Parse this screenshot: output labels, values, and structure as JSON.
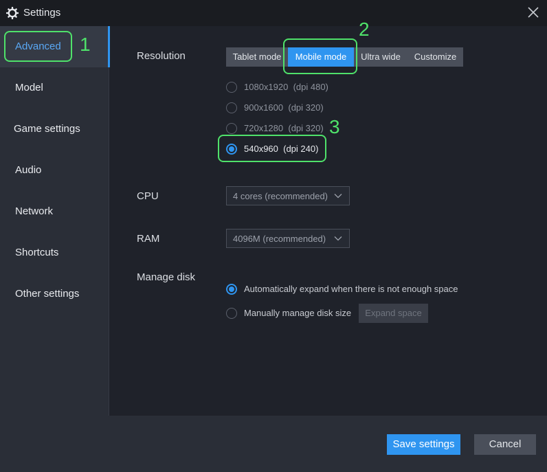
{
  "window": {
    "title": "Settings",
    "icon": "gear-icon",
    "close_icon": "close-icon"
  },
  "sidebar": {
    "items": [
      {
        "label": "Advanced",
        "active": true
      },
      {
        "label": "Model"
      },
      {
        "label": "Game settings"
      },
      {
        "label": "Audio"
      },
      {
        "label": "Network"
      },
      {
        "label": "Shortcuts"
      },
      {
        "label": "Other settings"
      }
    ]
  },
  "resolution": {
    "label": "Resolution",
    "modes": [
      "Tablet mode",
      "Mobile mode",
      "Ultra wide",
      "Customize"
    ],
    "selected_mode": "Mobile mode",
    "options": [
      {
        "size": "1080x1920",
        "dpi": "(dpi 480)",
        "checked": false
      },
      {
        "size": "900x1600",
        "dpi": "(dpi 320)",
        "checked": false
      },
      {
        "size": "720x1280",
        "dpi": "(dpi 320)",
        "checked": false
      },
      {
        "size": "540x960",
        "dpi": "(dpi 240)",
        "checked": true
      }
    ]
  },
  "cpu": {
    "label": "CPU",
    "value": "4 cores (recommended)"
  },
  "ram": {
    "label": "RAM",
    "value": "4096M (recommended)"
  },
  "disk": {
    "label": "Manage disk",
    "options": [
      {
        "text": "Automatically expand when there is not enough space",
        "checked": true
      },
      {
        "text": "Manually manage disk size",
        "checked": false
      }
    ],
    "expand_button": "Expand space"
  },
  "footer": {
    "save": "Save settings",
    "cancel": "Cancel"
  },
  "annotations": {
    "n1": "1",
    "n2": "2",
    "n3": "3"
  },
  "colors": {
    "accent": "#2f95f0",
    "highlight": "#4fe26a",
    "sidebar_bg": "#2a2e37",
    "main_bg": "#1f222a"
  }
}
